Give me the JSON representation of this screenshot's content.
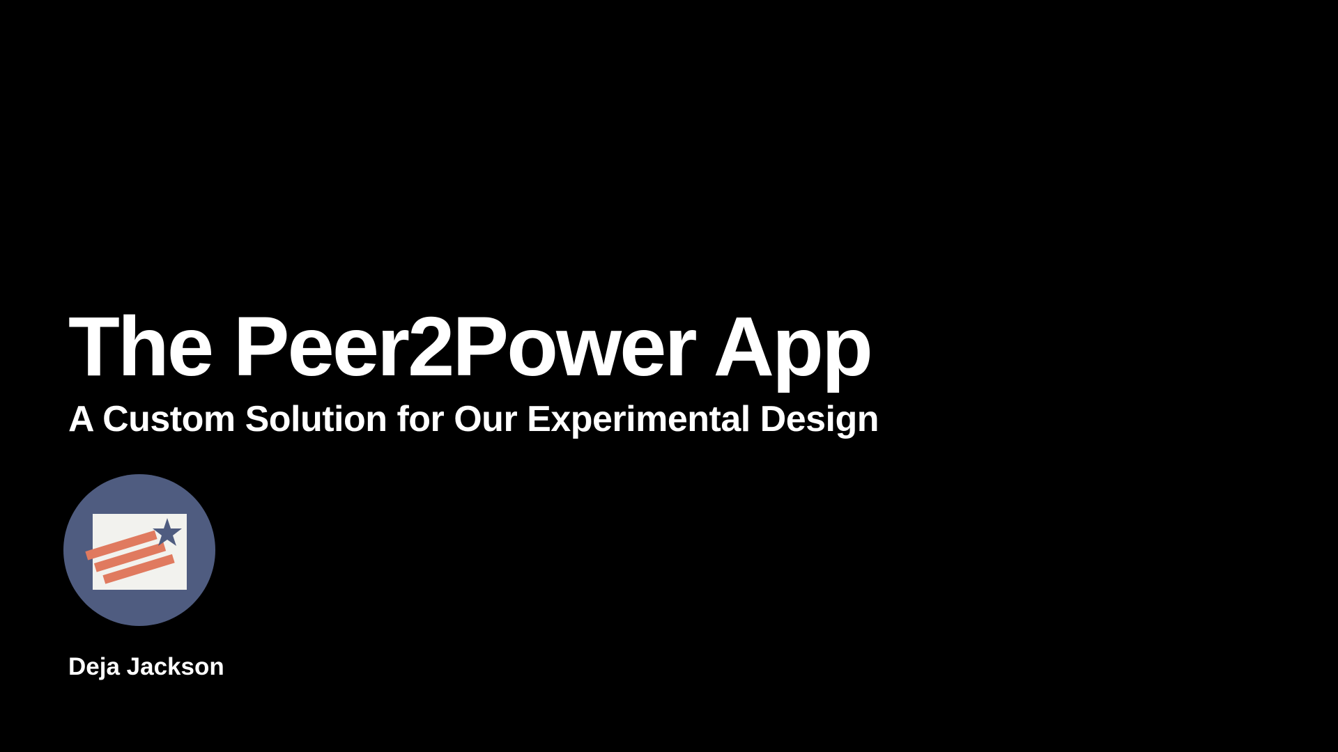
{
  "slide": {
    "title": "The Peer2Power App",
    "subtitle": "A Custom Solution for Our Experimental Design",
    "author": "Deja Jackson",
    "logo_icon": "flag-star-logo-icon"
  },
  "colors": {
    "background": "#000000",
    "text": "#ffffff",
    "logo_circle": "#4f5c80",
    "logo_card": "#f2f2ee",
    "logo_stripes": "#e07a5f",
    "logo_star": "#4f5c80"
  }
}
